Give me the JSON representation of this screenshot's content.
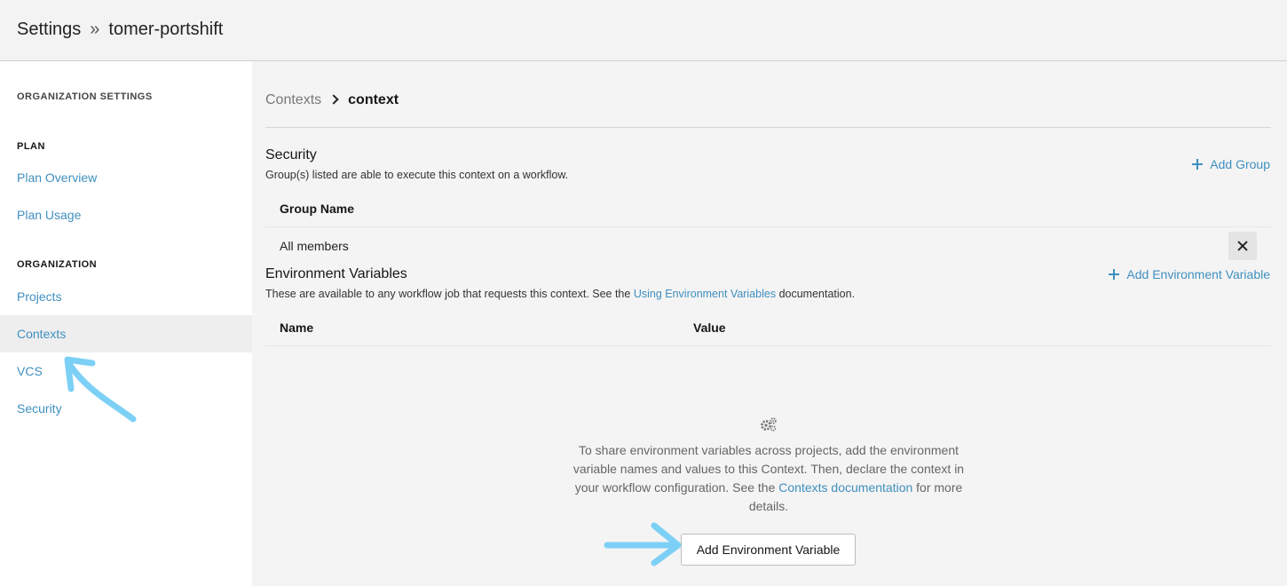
{
  "header": {
    "section": "Settings",
    "separator": "»",
    "org": "tomer-portshift"
  },
  "sidebar": {
    "org_settings_heading": "ORGANIZATION SETTINGS",
    "plan_heading": "PLAN",
    "plan_items": [
      "Plan Overview",
      "Plan Usage"
    ],
    "org_heading": "ORGANIZATION",
    "org_items": [
      "Projects",
      "Contexts",
      "VCS",
      "Security"
    ],
    "active_item": "Contexts"
  },
  "breadcrumb": {
    "parent": "Contexts",
    "current": "context"
  },
  "security": {
    "title": "Security",
    "description": "Group(s) listed are able to execute this context on a workflow.",
    "add_label": "Add Group",
    "column_header": "Group Name",
    "rows": [
      "All members"
    ]
  },
  "env": {
    "title": "Environment Variables",
    "description_before": "These are available to any workflow job that requests this context. See the ",
    "description_link": "Using Environment Variables",
    "description_after": " documentation.",
    "add_label": "Add Environment Variable",
    "columns": [
      "Name",
      "Value"
    ],
    "empty_icon": "gears-icon",
    "empty_text_before": "To share environment variables across projects, add the environment variable names and values to this Context. Then, declare the context in your workflow configuration. See the ",
    "empty_text_link": "Contexts documentation",
    "empty_text_after": " for more details.",
    "button_label": "Add Environment Variable"
  },
  "colors": {
    "link": "#3f8fbf",
    "annotation_arrow": "#7dd0f5",
    "active_bg": "#eeeeee"
  }
}
